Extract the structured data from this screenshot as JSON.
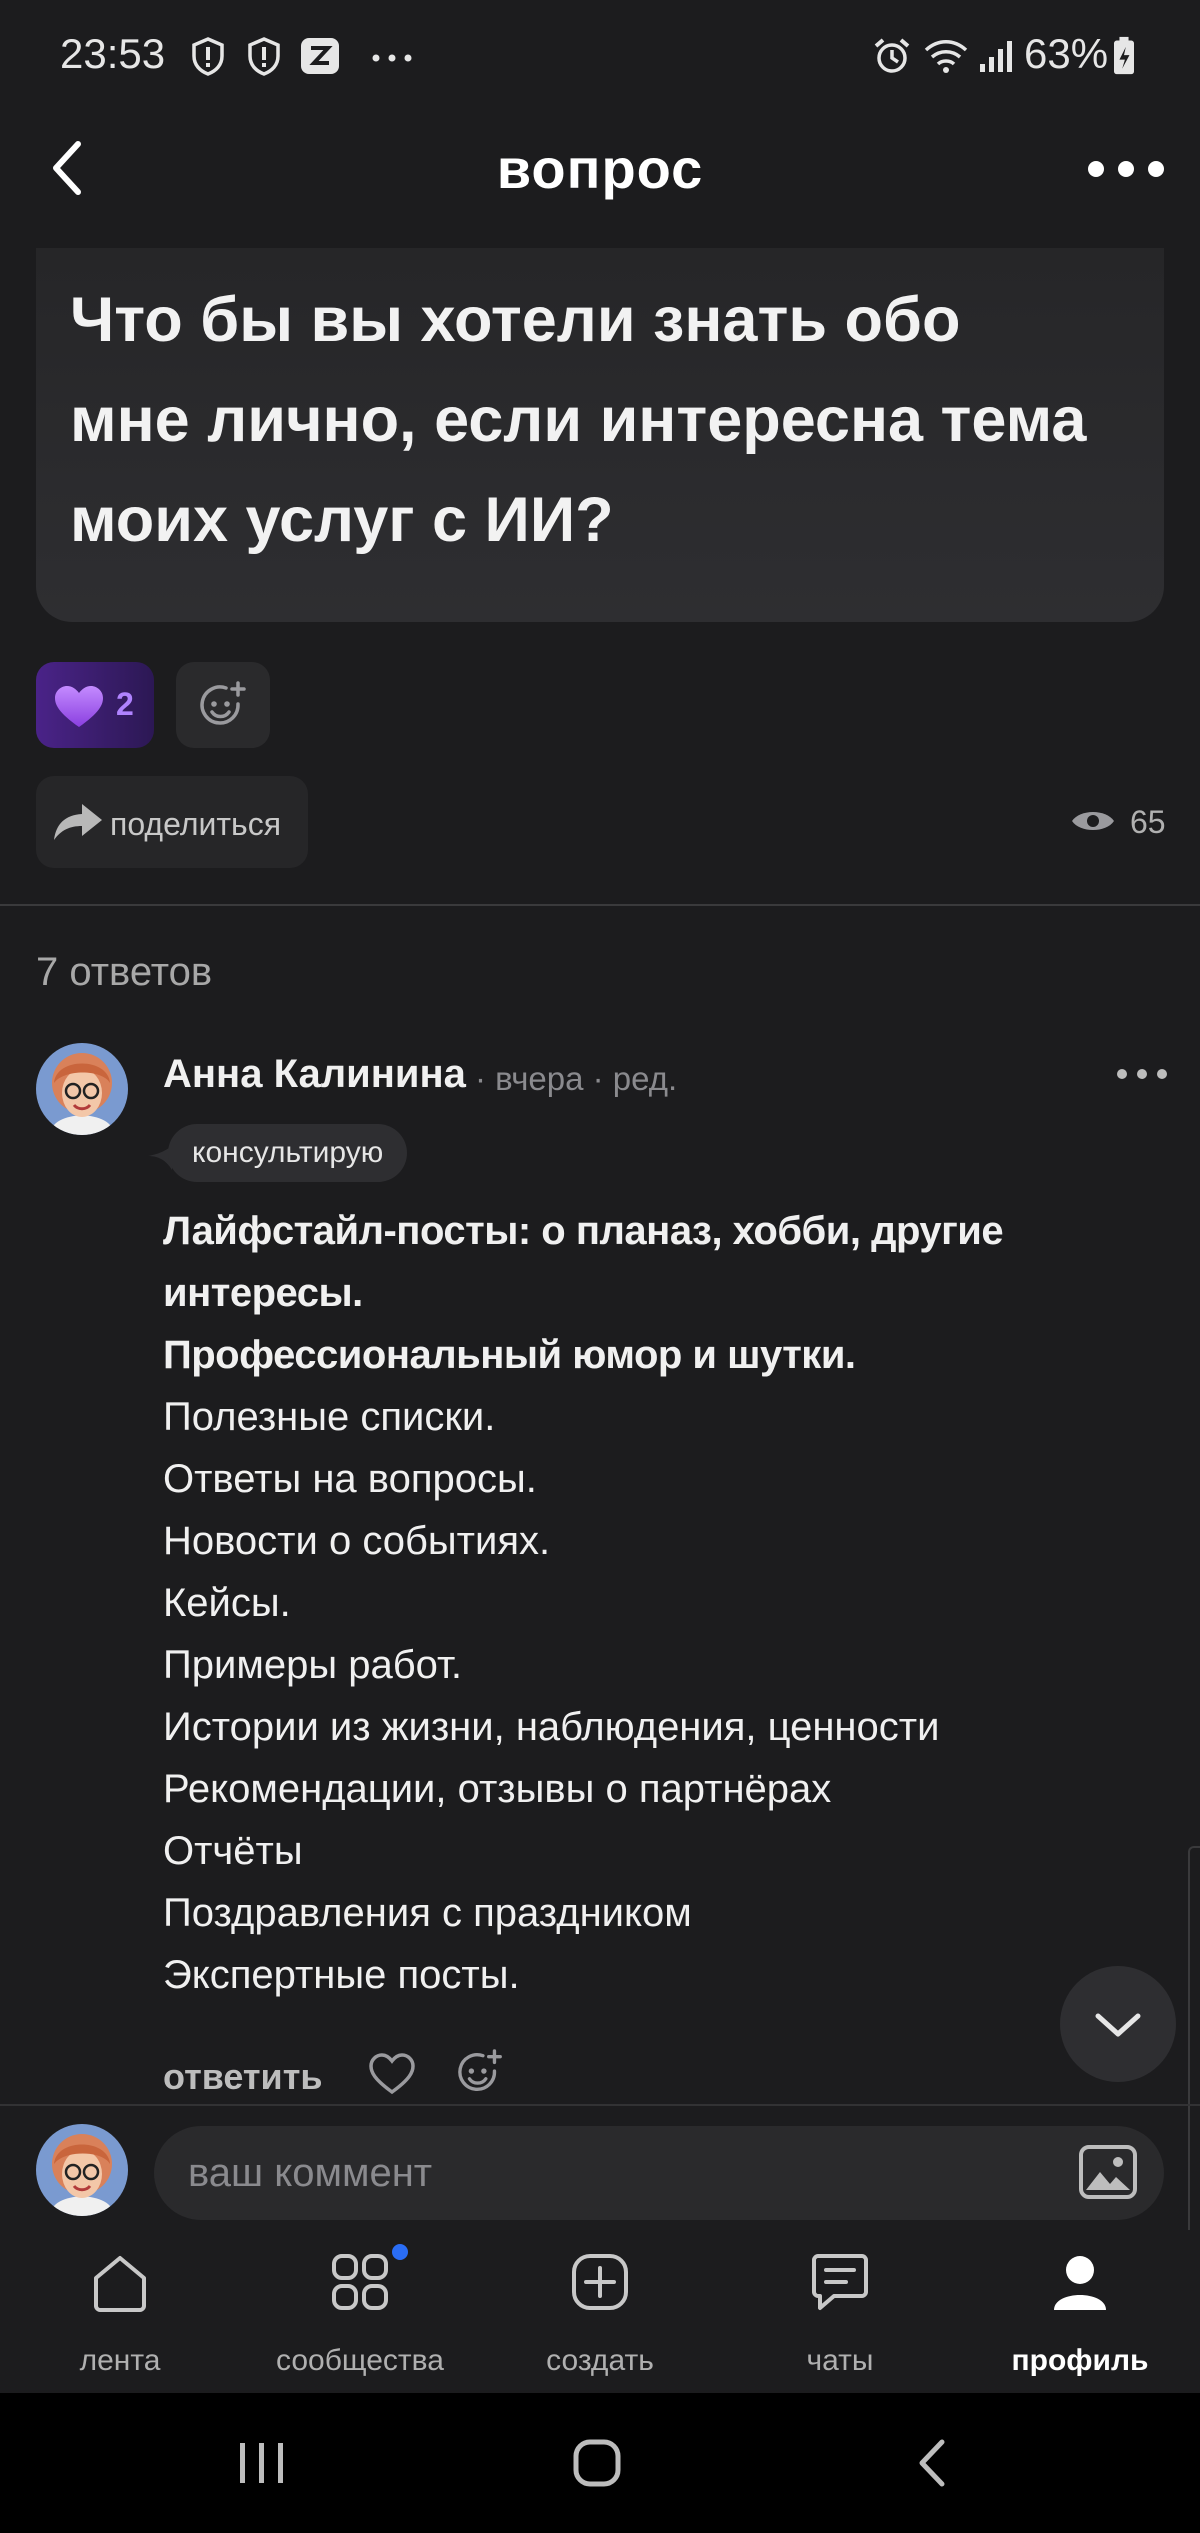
{
  "status_bar": {
    "time": "23:53",
    "battery": "63%",
    "icons": [
      "shield-alert-icon",
      "shield-alert-icon",
      "app-notification-icon",
      "more-notifications-icon",
      "alarm-icon",
      "wifi-icon",
      "signal-icon",
      "battery-icon"
    ]
  },
  "header": {
    "title": "вопрос"
  },
  "question": {
    "lines": [
      "Что бы вы хотели знать обо",
      "мне лично, если интересна тема",
      "моих услуг с ИИ?"
    ]
  },
  "reactions": {
    "like_count": "2"
  },
  "share": {
    "label": "поделиться",
    "views": "65"
  },
  "answers": {
    "count_label": "7 ответов"
  },
  "answer": {
    "author": "Анна Калинина",
    "meta": "· вчера · ред.",
    "badge": "консультирую",
    "bold_lines": [
      "Лайфстайл-посты: о планаз, хобби,  другие",
      "интересы.",
      "Профессиональный юмор и шутки."
    ],
    "lines": [
      "Полезные списки.",
      "Ответы на вопросы.",
      "Новости о событиях.",
      "Кейсы.",
      "Примеры работ.",
      "Истории из жизни, наблюдения, ценности",
      "Рекомендации, отзывы о партнёрах",
      "Отчёты",
      "Поздравления с праздником",
      "Экспертные посты."
    ],
    "reply_label": "ответить"
  },
  "composer": {
    "placeholder": "ваш коммент"
  },
  "bottom_nav": {
    "items": [
      {
        "label": "лента",
        "icon": "home-icon"
      },
      {
        "label": "сообщества",
        "icon": "communities-icon"
      },
      {
        "label": "создать",
        "icon": "create-icon"
      },
      {
        "label": "чаты",
        "icon": "chats-icon"
      },
      {
        "label": "профиль",
        "icon": "profile-icon"
      }
    ],
    "active": "профиль"
  },
  "colors": {
    "background": "#1c1c1e",
    "like_accent": "#b083ff",
    "notification_dot": "#2a6df5"
  }
}
